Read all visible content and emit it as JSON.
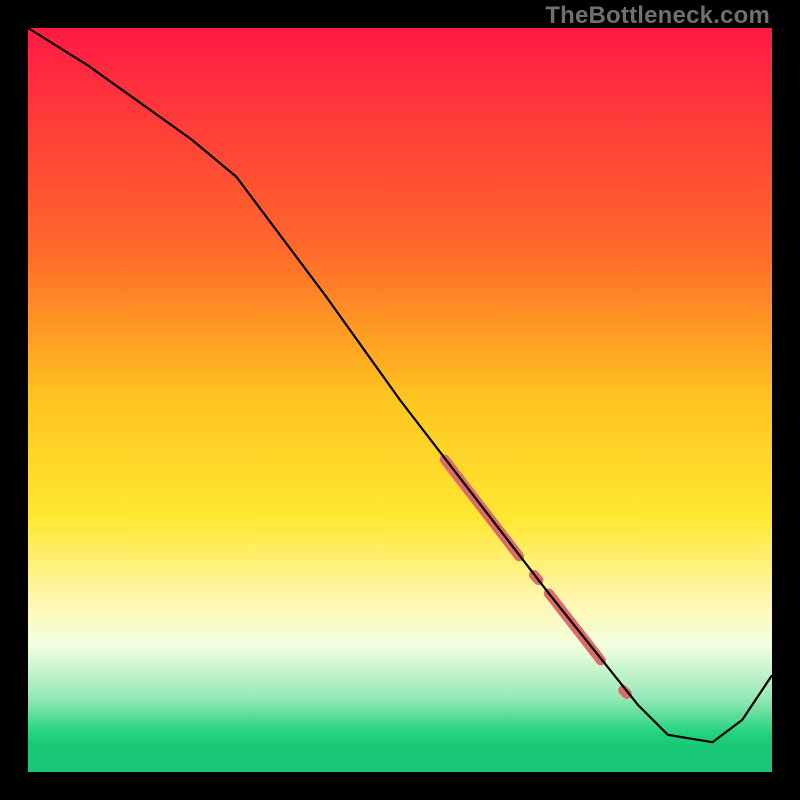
{
  "watermark": "TheBottleneck.com",
  "chart_data": {
    "type": "line",
    "title": "",
    "xlabel": "",
    "ylabel": "",
    "xlim": [
      0,
      100
    ],
    "ylim": [
      0,
      100
    ],
    "grid": false,
    "legend": false,
    "gradient_stops": [
      {
        "offset": 0,
        "color": "#ff1a44"
      },
      {
        "offset": 0.3,
        "color": "#ff6a2a"
      },
      {
        "offset": 0.5,
        "color": "#ffc51f"
      },
      {
        "offset": 0.66,
        "color": "#ffe833"
      },
      {
        "offset": 0.77,
        "color": "#fff7b0"
      },
      {
        "offset": 0.83,
        "color": "#f3ffe0"
      },
      {
        "offset": 0.9,
        "color": "#97e8b7"
      },
      {
        "offset": 0.945,
        "color": "#28d47f"
      },
      {
        "offset": 0.965,
        "color": "#19c976"
      },
      {
        "offset": 1.0,
        "color": "#17c574"
      }
    ],
    "series": [
      {
        "name": "bottleneck-curve",
        "color": "#000000",
        "stroke_width": 2.2,
        "x": [
          0,
          8,
          15,
          22,
          28,
          40,
          50,
          60,
          70,
          78,
          82,
          86,
          92,
          96,
          100
        ],
        "y": [
          100,
          95,
          90,
          85,
          80,
          64,
          50,
          37,
          24,
          14,
          9,
          5,
          4,
          7,
          13
        ]
      }
    ],
    "highlight_segments": [
      {
        "name": "band-upper",
        "color": "#de6a6a",
        "width": 10,
        "x": [
          56,
          66
        ],
        "y": [
          42,
          29
        ]
      },
      {
        "name": "band-gap-dot",
        "color": "#de6a6a",
        "width": 10,
        "x": [
          68,
          68.6
        ],
        "y": [
          26.5,
          25.8
        ]
      },
      {
        "name": "band-lower",
        "color": "#de6a6a",
        "width": 10,
        "x": [
          70,
          77
        ],
        "y": [
          24,
          15
        ]
      },
      {
        "name": "band-tiny",
        "color": "#de6a6a",
        "width": 10,
        "x": [
          80,
          80.5
        ],
        "y": [
          11,
          10.5
        ]
      }
    ]
  }
}
